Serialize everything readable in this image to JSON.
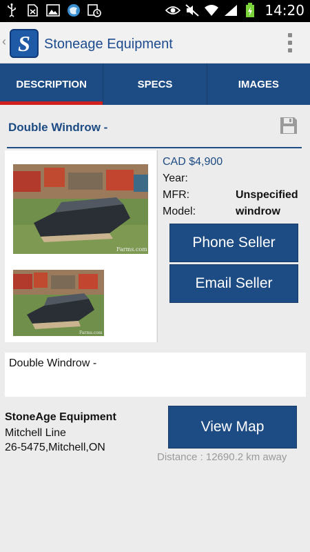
{
  "status_bar": {
    "time": "14:20",
    "icons": [
      "usb-icon",
      "sim-card-blocked-icon",
      "image-icon",
      "globe-app-icon",
      "calendar-clock-icon",
      "eye-icon",
      "mute-icon",
      "wifi-icon",
      "signal-icon",
      "battery-charging-icon"
    ]
  },
  "app_bar": {
    "title": "Stoneage Equipment",
    "logo_letter": "S",
    "back_glyph": "‹",
    "brand_color": "#1d4b84"
  },
  "tabs": [
    {
      "label": "DESCRIPTION",
      "active": true
    },
    {
      "label": "SPECS",
      "active": false
    },
    {
      "label": "IMAGES",
      "active": false
    }
  ],
  "listing": {
    "title": "Double Windrow -",
    "price": "CAD $4,900",
    "year_label": "Year:",
    "year_value": "",
    "mfr_label": "MFR:",
    "mfr_value": "Unspecified",
    "model_label": "Model:",
    "model_value": "windrow",
    "photo_watermark": "Farms.com",
    "description": "Double Windrow -"
  },
  "actions": {
    "phone_label": "Phone Seller",
    "email_label": "Email Seller",
    "map_label": "View Map"
  },
  "seller": {
    "name": "StoneAge Equipment",
    "address_line1": "Mitchell Line",
    "address_line2": "26-5475,Mitchell,ON",
    "distance": "Distance : 12690.2 km away"
  }
}
